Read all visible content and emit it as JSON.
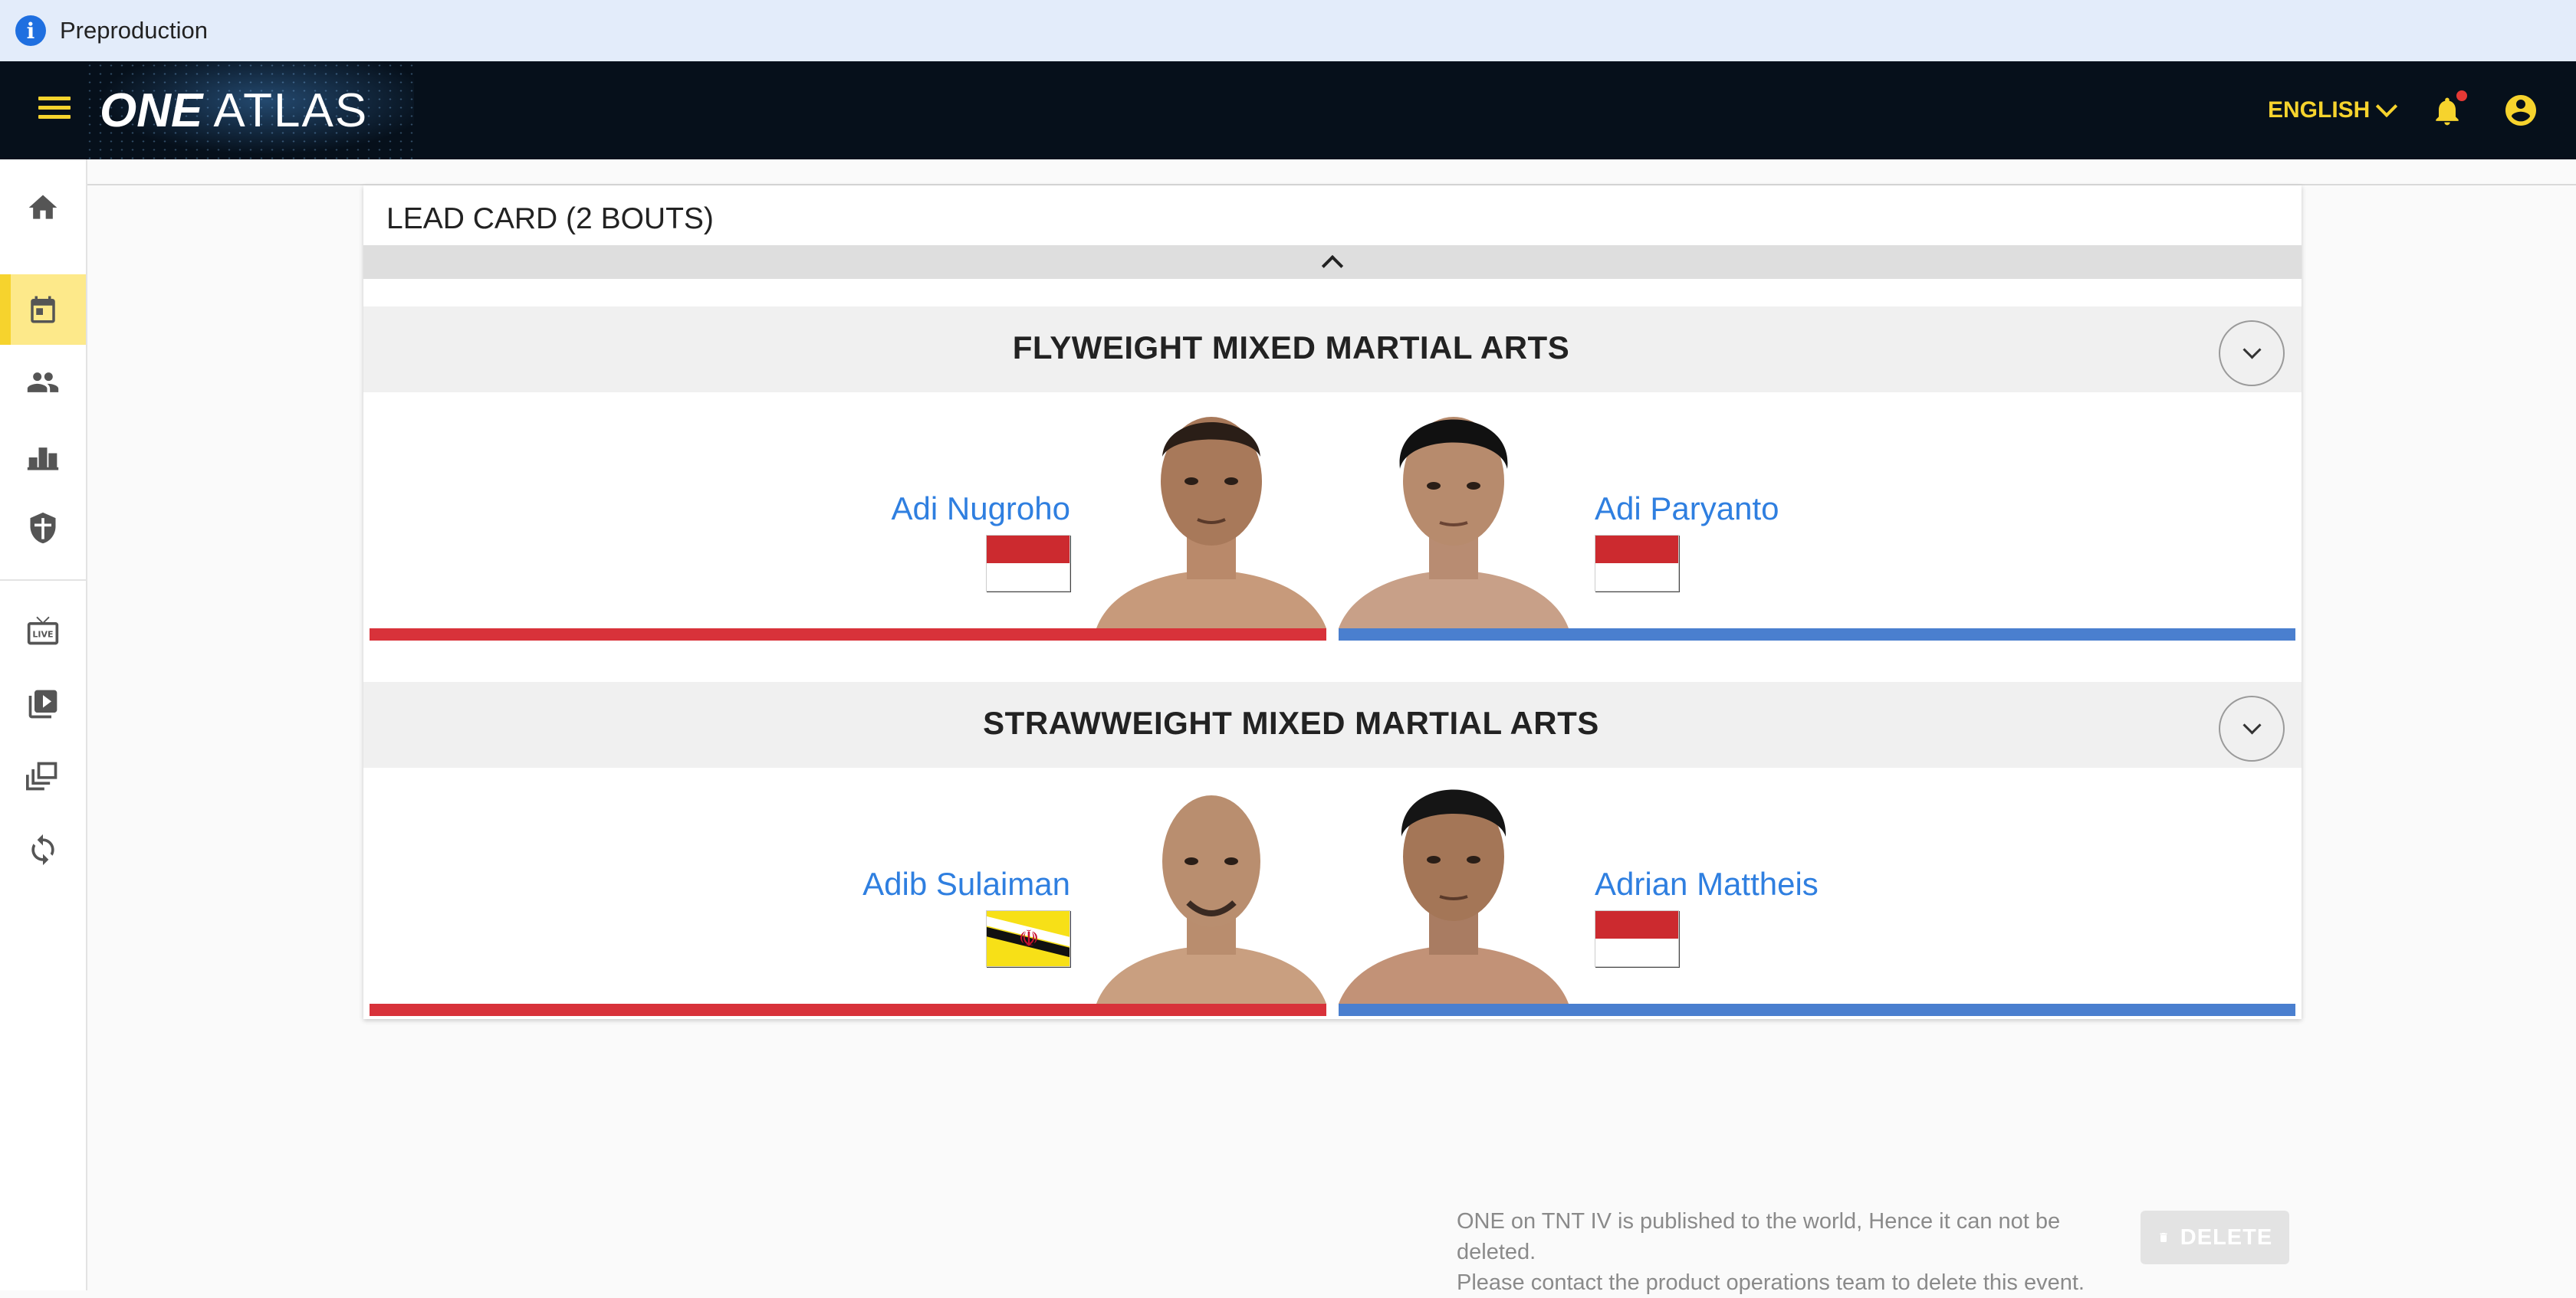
{
  "env_banner": {
    "label": "Preproduction",
    "icon": "info-icon",
    "color": "#1f6fe0"
  },
  "app_bar": {
    "logo": {
      "one": "ONE",
      "atlas": "ATLAS"
    },
    "language": "ENGLISH",
    "notifications_unread": true,
    "accent": "#f6d32d",
    "background": "#06101b"
  },
  "sidebar": {
    "items": [
      {
        "icon": "home-icon",
        "active": false
      },
      {
        "icon": "calendar-icon",
        "active": true
      },
      {
        "icon": "people-icon",
        "active": false
      },
      {
        "icon": "podium-icon",
        "active": false
      },
      {
        "icon": "shield-icon",
        "active": false
      },
      {
        "icon": "live-tv-icon",
        "active": false
      },
      {
        "icon": "video-library-icon",
        "active": false
      },
      {
        "icon": "collections-icon",
        "active": false
      },
      {
        "icon": "sync-icon",
        "active": false
      }
    ]
  },
  "card": {
    "title": "LEAD CARD (2 BOUTS)",
    "bouts": [
      {
        "title": "FLYWEIGHT MIXED MARTIAL ARTS",
        "red": {
          "name": "Adi Nugroho",
          "flag": "indonesia-flag"
        },
        "blue": {
          "name": "Adi Paryanto",
          "flag": "indonesia-flag"
        }
      },
      {
        "title": "STRAWWEIGHT MIXED MARTIAL ARTS",
        "red": {
          "name": "Adib Sulaiman",
          "flag": "brunei-flag"
        },
        "blue": {
          "name": "Adrian Mattheis",
          "flag": "indonesia-flag"
        }
      }
    ]
  },
  "footer": {
    "note_line1": "ONE on TNT IV is published to the world, Hence it can not be deleted.",
    "note_line2": "Please contact the product operations team to delete this event.",
    "delete_label": "DELETE"
  },
  "colors": {
    "red_corner": "#d8323a",
    "blue_corner": "#4a7fcf",
    "link": "#2f7fe0",
    "active_nav": "#fde98a"
  }
}
